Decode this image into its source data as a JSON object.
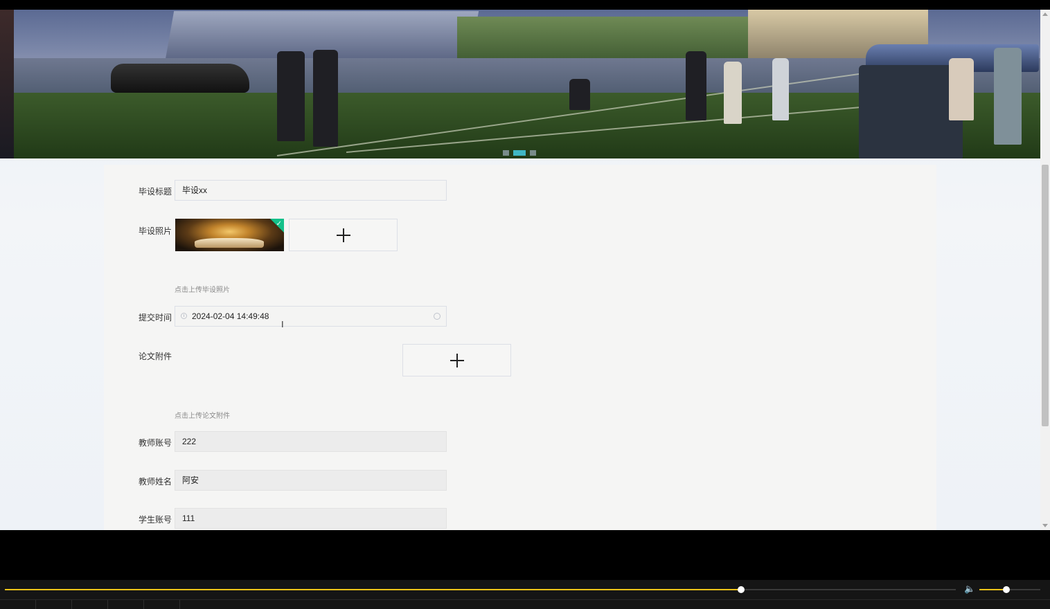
{
  "form": {
    "title_label": "毕设标题",
    "title_value": "毕设xx",
    "photo_label": "毕设照片",
    "photo_hint": "点击上传毕设照片",
    "submit_time_label": "提交时间",
    "submit_time_value": "2024-02-04 14:49:48",
    "attachment_label": "论文附件",
    "attachment_hint": "点击上传论文附件",
    "teacher_account_label": "教师账号",
    "teacher_account_value": "222",
    "teacher_name_label": "教师姓名",
    "teacher_name_value": "阿安",
    "student_account_label": "学生账号",
    "student_account_value": "111"
  },
  "carousel": {
    "active_index": 1,
    "count": 3
  },
  "player": {
    "progress_fraction": 0.774,
    "volume_fraction": 0.44
  },
  "colors": {
    "accent": "#3fb7c4",
    "success_corner": "#13c08a",
    "progress": "#f0c419"
  },
  "icons": {
    "add": "plus-icon",
    "time": "clock-icon",
    "clear": "circle-close-icon",
    "volume": "speaker-icon"
  }
}
